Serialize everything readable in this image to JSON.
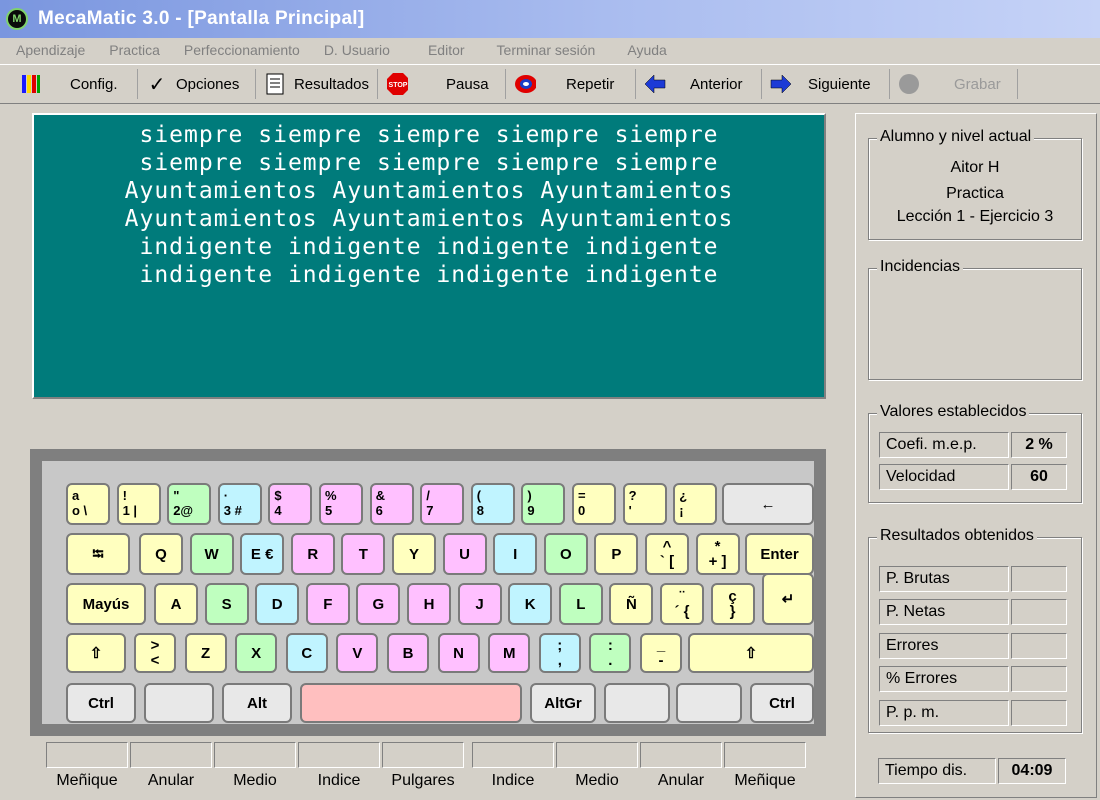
{
  "window": {
    "title": "MecaMatic 3.0  - [Pantalla Principal]",
    "icon": "mecamatic-logo-icon",
    "icon_text": "M"
  },
  "menu": [
    "Apendizaje",
    "Practica",
    "Perfeccionamiento",
    "D. Usuario",
    "Editor",
    "Terminar sesión",
    "Ayuda"
  ],
  "toolbar": {
    "config": "Config.",
    "opciones": "Opciones",
    "resultados": "Resultados",
    "pausa": "Pausa",
    "repetir": "Repetir",
    "anterior": "Anterior",
    "siguiente": "Siguiente",
    "grabar": "Grabar",
    "stop_text": "STOP"
  },
  "exercise_text": [
    "siempre siempre siempre siempre siempre",
    "siempre siempre siempre siempre siempre",
    "Ayuntamientos Ayuntamientos Ayuntamientos",
    "Ayuntamientos Ayuntamientos Ayuntamientos",
    "indigente indigente indigente indigente",
    "indigente indigente indigente indigente"
  ],
  "keyboard": {
    "row1": [
      "a\no \\",
      "!\n1 |",
      "\"\n2@",
      "·\n3 #",
      "$\n4",
      "%\n5",
      "&\n6",
      "/\n7",
      "(\n8",
      ")\n9",
      "=\n0",
      "?\n'",
      "¿\n¡",
      "←"
    ],
    "row2": [
      "⭾",
      "Q",
      "W",
      "E €",
      "R",
      "T",
      "Y",
      "U",
      "I",
      "O",
      "P",
      "^\n` [",
      "*\n+ ]",
      "Enter"
    ],
    "row3": [
      "Mayús",
      "A",
      "S",
      "D",
      "F",
      "G",
      "H",
      "J",
      "K",
      "L",
      "Ñ",
      "¨\n´ {",
      "ç\n}",
      "↵"
    ],
    "row4": [
      "⇧",
      ">\n<",
      "Z",
      "X",
      "C",
      "V",
      "B",
      "N",
      "M",
      ";\n,",
      ":\n.",
      "_\n-",
      "⇧"
    ],
    "row5": [
      "Ctrl",
      "",
      "Alt",
      "",
      "AltGr",
      "",
      "",
      "Ctrl"
    ],
    "colors": {
      "yellow": "#ffffbf",
      "green": "#bfffbf",
      "cyan": "#c0f4ff",
      "pink": "#ffc0ff",
      "space": "#ffbfbf"
    }
  },
  "fingers": [
    "Meñique",
    "Anular",
    "Medio",
    "Indice",
    "Pulgares",
    "Indice",
    "Medio",
    "Anular",
    "Meñique"
  ],
  "student": {
    "title": "Alumno y nivel actual",
    "name": "Aitor H",
    "mode": "Practica",
    "lesson": "Lección 1 - Ejercicio  3"
  },
  "incidencias": {
    "title": "Incidencias"
  },
  "valores": {
    "title": "Valores establecidos",
    "coef_label": "Coefi. m.e.p.",
    "coef_value": "2 %",
    "velocidad_label": "Velocidad",
    "velocidad_value": "60"
  },
  "resultados": {
    "title": "Resultados obtenidos",
    "rows": [
      {
        "label": "P. Brutas",
        "value": ""
      },
      {
        "label": "P. Netas",
        "value": ""
      },
      {
        "label": "Errores",
        "value": ""
      },
      {
        "label": "%  Errores",
        "value": ""
      },
      {
        "label": "P. p. m.",
        "value": ""
      }
    ]
  },
  "tiempo": {
    "label": "Tiempo dis.",
    "value": "04:09"
  }
}
